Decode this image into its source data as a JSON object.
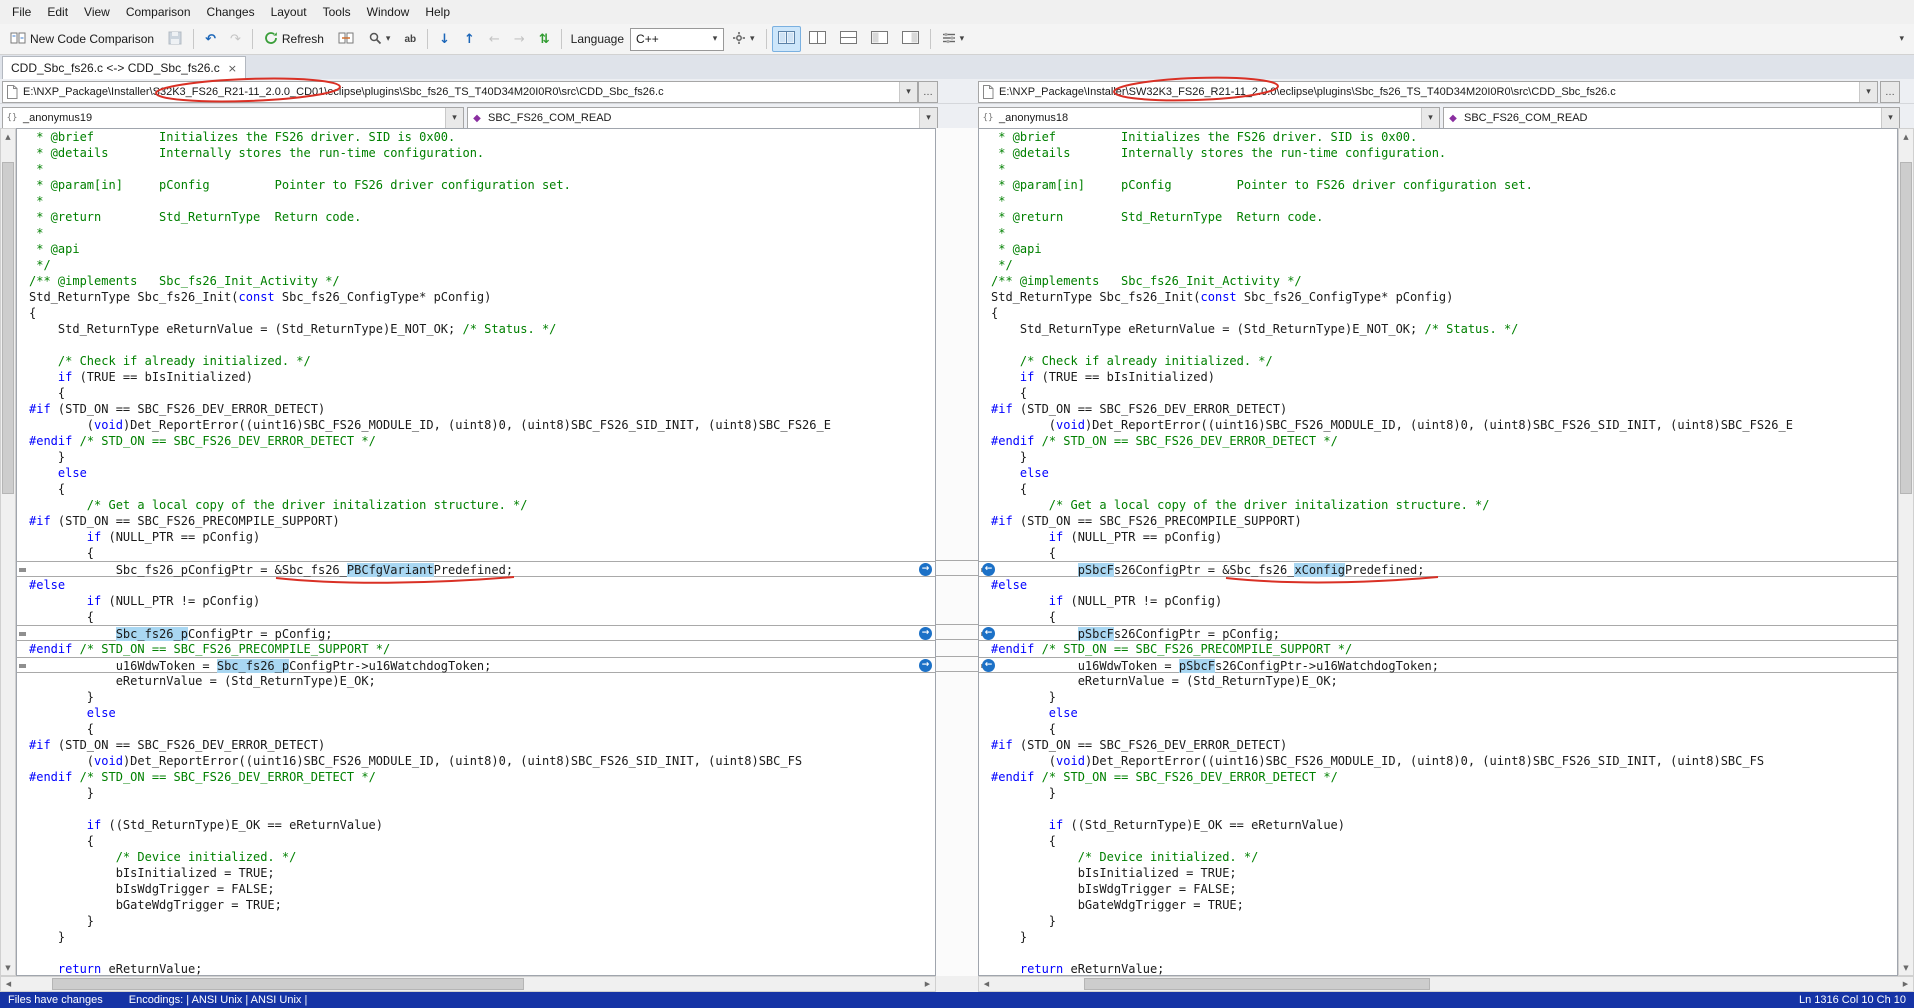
{
  "menu": [
    "File",
    "Edit",
    "View",
    "Comparison",
    "Changes",
    "Layout",
    "Tools",
    "Window",
    "Help"
  ],
  "toolbar": {
    "new_comparison": "New Code Comparison",
    "refresh": "Refresh",
    "language_label": "Language",
    "language_value": "C++",
    "ab": "ab"
  },
  "tab": {
    "label": "CDD_Sbc_fs26.c <-> CDD_Sbc_fs26.c"
  },
  "icons": {
    "dropdown": "▾",
    "close": "×",
    "up": "▲",
    "down": "▼",
    "left": "◀",
    "right": "▶",
    "undo": "↶",
    "redo": "↷",
    "next_diff": "↓",
    "prev_diff": "↑",
    "nav_left": "←",
    "nav_right": "→",
    "swap": "⇅",
    "copy_right": "→",
    "copy_left": "←",
    "browse": "…",
    "scope": "{}",
    "method": "◆"
  },
  "statusbar": {
    "message": "Files have changes",
    "encodings": "Encodings: | ANSI Unix | ANSI Unix |",
    "position": "Ln 1316  Col 10  Ch 10"
  },
  "panes": [
    {
      "path": "E:\\NXP_Package\\Installer\\S32K3_FS26_R21-11_2.0.0_CD01\\eclipse\\plugins\\Sbc_fs26_TS_T40D34M20I0R0\\src\\CDD_Sbc_fs26.c",
      "scope": "_anonymus19",
      "member": "SBC_FS26_COM_READ",
      "code": [
        [
          [
            " * @brief         Initializes the FS26 driver. SID is 0x00.",
            "cm"
          ]
        ],
        [
          [
            " * @details       Internally stores the run-time configuration.",
            "cm"
          ]
        ],
        [
          [
            " *",
            "cm"
          ]
        ],
        [
          [
            " * @param[in]     pConfig         Pointer to FS26 driver configuration set.",
            "cm"
          ]
        ],
        [
          [
            " *",
            "cm"
          ]
        ],
        [
          [
            " * @return        Std_ReturnType  Return code.",
            "cm"
          ]
        ],
        [
          [
            " *",
            "cm"
          ]
        ],
        [
          [
            " * @api",
            "cm"
          ]
        ],
        [
          [
            " */",
            "cm"
          ]
        ],
        [
          [
            "/** @implements   Sbc_fs26_Init_Activity */",
            "cm"
          ]
        ],
        [
          [
            "Std_ReturnType Sbc_fs26_Init(",
            ""
          ],
          [
            "const",
            "kw"
          ],
          [
            " Sbc_fs26_ConfigType* pConfig)",
            ""
          ]
        ],
        "{",
        [
          [
            "    Std_ReturnType eReturnValue = (Std_ReturnType)E_NOT_OK; ",
            ""
          ],
          [
            "/* Status. */",
            "cm"
          ]
        ],
        "",
        [
          [
            "    /* Check if already initialized. */",
            "cm"
          ]
        ],
        [
          [
            "    ",
            ""
          ],
          [
            "if",
            "kw"
          ],
          [
            " (TRUE == bIsInitialized)",
            ""
          ]
        ],
        "    {",
        [
          [
            "#if",
            "pp"
          ],
          [
            " (STD_ON == SBC_FS26_DEV_ERROR_DETECT)",
            ""
          ]
        ],
        [
          [
            "        (",
            ""
          ],
          [
            "void",
            "kw"
          ],
          [
            ")Det_ReportError((uint16)SBC_FS26_MODULE_ID, (uint8)0, (uint8)SBC_FS26_SID_INIT, (uint8)SBC_FS26_E",
            ""
          ]
        ],
        [
          [
            "#endif",
            "pp"
          ],
          [
            " ",
            ""
          ],
          [
            "/* STD_ON == SBC_FS26_DEV_ERROR_DETECT */",
            "cm"
          ]
        ],
        "    }",
        [
          [
            "    ",
            ""
          ],
          [
            "else",
            "kw"
          ]
        ],
        "    {",
        [
          [
            "        /* Get a local copy of the driver initalization structure. */",
            "cm"
          ]
        ],
        [
          [
            "#if",
            "pp"
          ],
          [
            " (STD_ON == SBC_FS26_PRECOMPILE_SUPPORT)",
            ""
          ]
        ],
        [
          [
            "        ",
            ""
          ],
          [
            "if",
            "kw"
          ],
          [
            " (NULL_PTR == pConfig)",
            ""
          ]
        ],
        "        {",
        {
          "d": 1,
          "s": [
            [
              "            Sbc_fs26_pConfigPtr = &Sbc_fs26_",
              ""
            ],
            [
              "PBCfgVariant",
              "hl"
            ],
            [
              "Predefined;",
              ""
            ]
          ]
        },
        [
          [
            "#else",
            "pp"
          ]
        ],
        [
          [
            "        ",
            ""
          ],
          [
            "if",
            "kw"
          ],
          [
            " (NULL_PTR != pConfig)",
            ""
          ]
        ],
        "        {",
        {
          "d": 1,
          "s": [
            [
              "            ",
              ""
            ],
            [
              "Sbc_fs26_p",
              "hl"
            ],
            [
              "ConfigPtr = pConfig;",
              ""
            ]
          ]
        },
        [
          [
            "#endif",
            "pp"
          ],
          [
            " ",
            ""
          ],
          [
            "/* STD_ON == SBC_FS26_PRECOMPILE_SUPPORT */",
            "cm"
          ]
        ],
        {
          "d": 1,
          "s": [
            [
              "            u16WdwToken = ",
              ""
            ],
            [
              "Sbc_fs26_p",
              "hl"
            ],
            [
              "ConfigPtr->u16WatchdogToken;",
              ""
            ]
          ]
        },
        "            eReturnValue = (Std_ReturnType)E_OK;",
        "        }",
        [
          [
            "        ",
            ""
          ],
          [
            "else",
            "kw"
          ]
        ],
        "        {",
        [
          [
            "#if",
            "pp"
          ],
          [
            " (STD_ON == SBC_FS26_DEV_ERROR_DETECT)",
            ""
          ]
        ],
        [
          [
            "        (",
            ""
          ],
          [
            "void",
            "kw"
          ],
          [
            ")Det_ReportError((uint16)SBC_FS26_MODULE_ID, (uint8)0, (uint8)SBC_FS26_SID_INIT, (uint8)SBC_FS",
            ""
          ]
        ],
        [
          [
            "#endif",
            "pp"
          ],
          [
            " ",
            ""
          ],
          [
            "/* STD_ON == SBC_FS26_DEV_ERROR_DETECT */",
            "cm"
          ]
        ],
        "        }",
        "",
        [
          [
            "        ",
            ""
          ],
          [
            "if",
            "kw"
          ],
          [
            " ((Std_ReturnType)E_OK == eReturnValue)",
            ""
          ]
        ],
        "        {",
        [
          [
            "            /* Device initialized. */",
            "cm"
          ]
        ],
        "            bIsInitialized = TRUE;",
        "            bIsWdgTrigger = FALSE;",
        "            bGateWdgTrigger = TRUE;",
        "        }",
        "    }",
        "",
        [
          [
            "    ",
            ""
          ],
          [
            "return",
            "kw"
          ],
          [
            " eReturnValue;",
            ""
          ]
        ]
      ]
    },
    {
      "path": "E:\\NXP_Package\\Installer\\SW32K3_FS26_R21-11_2.0.0\\eclipse\\plugins\\Sbc_fs26_TS_T40D34M20I0R0\\src\\CDD_Sbc_fs26.c",
      "scope": "_anonymus18",
      "member": "SBC_FS26_COM_READ",
      "code": [
        [
          [
            " * @brief         Initializes the FS26 driver. SID is 0x00.",
            "cm"
          ]
        ],
        [
          [
            " * @details       Internally stores the run-time configuration.",
            "cm"
          ]
        ],
        [
          [
            " *",
            "cm"
          ]
        ],
        [
          [
            " * @param[in]     pConfig         Pointer to FS26 driver configuration set.",
            "cm"
          ]
        ],
        [
          [
            " *",
            "cm"
          ]
        ],
        [
          [
            " * @return        Std_ReturnType  Return code.",
            "cm"
          ]
        ],
        [
          [
            " *",
            "cm"
          ]
        ],
        [
          [
            " * @api",
            "cm"
          ]
        ],
        [
          [
            " */",
            "cm"
          ]
        ],
        [
          [
            "/** @implements   Sbc_fs26_Init_Activity */",
            "cm"
          ]
        ],
        [
          [
            "Std_ReturnType Sbc_fs26_Init(",
            ""
          ],
          [
            "const",
            "kw"
          ],
          [
            " Sbc_fs26_ConfigType* pConfig)",
            ""
          ]
        ],
        "{",
        [
          [
            "    Std_ReturnType eReturnValue = (Std_ReturnType)E_NOT_OK; ",
            ""
          ],
          [
            "/* Status. */",
            "cm"
          ]
        ],
        "",
        [
          [
            "    /* Check if already initialized. */",
            "cm"
          ]
        ],
        [
          [
            "    ",
            ""
          ],
          [
            "if",
            "kw"
          ],
          [
            " (TRUE == bIsInitialized)",
            ""
          ]
        ],
        "    {",
        [
          [
            "#if",
            "pp"
          ],
          [
            " (STD_ON == SBC_FS26_DEV_ERROR_DETECT)",
            ""
          ]
        ],
        [
          [
            "        (",
            ""
          ],
          [
            "void",
            "kw"
          ],
          [
            ")Det_ReportError((uint16)SBC_FS26_MODULE_ID, (uint8)0, (uint8)SBC_FS26_SID_INIT, (uint8)SBC_FS26_E",
            ""
          ]
        ],
        [
          [
            "#endif",
            "pp"
          ],
          [
            " ",
            ""
          ],
          [
            "/* STD_ON == SBC_FS26_DEV_ERROR_DETECT */",
            "cm"
          ]
        ],
        "    }",
        [
          [
            "    ",
            ""
          ],
          [
            "else",
            "kw"
          ]
        ],
        "    {",
        [
          [
            "        /* Get a local copy of the driver initalization structure. */",
            "cm"
          ]
        ],
        [
          [
            "#if",
            "pp"
          ],
          [
            " (STD_ON == SBC_FS26_PRECOMPILE_SUPPORT)",
            ""
          ]
        ],
        [
          [
            "        ",
            ""
          ],
          [
            "if",
            "kw"
          ],
          [
            " (NULL_PTR == pConfig)",
            ""
          ]
        ],
        "        {",
        {
          "d": 1,
          "s": [
            [
              "            ",
              ""
            ],
            [
              "pSbcF",
              "hl"
            ],
            [
              "s26ConfigPtr = &Sbc_fs26_",
              ""
            ],
            [
              "xConfig",
              "hl"
            ],
            [
              "Predefined;",
              ""
            ]
          ]
        },
        [
          [
            "#else",
            "pp"
          ]
        ],
        [
          [
            "        ",
            ""
          ],
          [
            "if",
            "kw"
          ],
          [
            " (NULL_PTR != pConfig)",
            ""
          ]
        ],
        "        {",
        {
          "d": 1,
          "s": [
            [
              "            ",
              ""
            ],
            [
              "pSbcF",
              "hl"
            ],
            [
              "s26ConfigPtr = pConfig;",
              ""
            ]
          ]
        },
        [
          [
            "#endif",
            "pp"
          ],
          [
            " ",
            ""
          ],
          [
            "/* STD_ON == SBC_FS26_PRECOMPILE_SUPPORT */",
            "cm"
          ]
        ],
        {
          "d": 1,
          "s": [
            [
              "            u16WdwToken = ",
              ""
            ],
            [
              "pSbcF",
              "hl"
            ],
            [
              "s26ConfigPtr->u16WatchdogToken;",
              ""
            ]
          ]
        },
        "            eReturnValue = (Std_ReturnType)E_OK;",
        "        }",
        [
          [
            "        ",
            ""
          ],
          [
            "else",
            "kw"
          ]
        ],
        "        {",
        [
          [
            "#if",
            "pp"
          ],
          [
            " (STD_ON == SBC_FS26_DEV_ERROR_DETECT)",
            ""
          ]
        ],
        [
          [
            "        (",
            ""
          ],
          [
            "void",
            "kw"
          ],
          [
            ")Det_ReportError((uint16)SBC_FS26_MODULE_ID, (uint8)0, (uint8)SBC_FS26_SID_INIT, (uint8)SBC_FS",
            ""
          ]
        ],
        [
          [
            "#endif",
            "pp"
          ],
          [
            " ",
            ""
          ],
          [
            "/* STD_ON == SBC_FS26_DEV_ERROR_DETECT */",
            "cm"
          ]
        ],
        "        }",
        "",
        [
          [
            "        ",
            ""
          ],
          [
            "if",
            "kw"
          ],
          [
            " ((Std_ReturnType)E_OK == eReturnValue)",
            ""
          ]
        ],
        [
          [
            "        {",
            ""
          ],
          [
            "",
            "caret"
          ]
        ],
        [
          [
            "            /* Device initialized. */",
            "cm"
          ]
        ],
        "            bIsInitialized = TRUE;",
        "            bIsWdgTrigger = FALSE;",
        "            bGateWdgTrigger = TRUE;",
        "        }",
        "    }",
        "",
        [
          [
            "    ",
            ""
          ],
          [
            "return",
            "kw"
          ],
          [
            " eReturnValue;",
            ""
          ]
        ]
      ]
    }
  ],
  "colors": {
    "keyword": "#0000ff",
    "comment": "#008000",
    "diff_highlight": "#a9d7f2",
    "statusbar": "#1533a5",
    "annotation": "#d93025"
  }
}
